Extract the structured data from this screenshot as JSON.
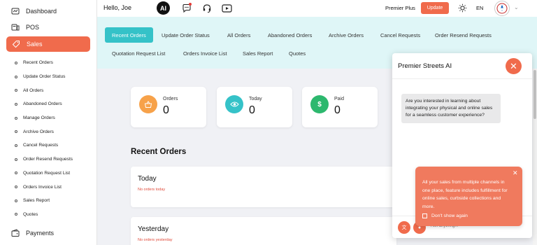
{
  "sidebar": {
    "dashboard": "Dashboard",
    "pos": "POS",
    "sales": "Sales",
    "payments": "Payments",
    "sub_items": [
      "Recent Orders",
      "Update Order Status",
      "All Orders",
      "Abandoned Orders",
      "Manage Orders",
      "Archive Orders",
      "Cancel Requests",
      "Order Resend Requests",
      "Quotation Request List",
      "Orders Invoice List",
      "Sales Report",
      "Quotes"
    ]
  },
  "topbar": {
    "greeting": "Hello, Joe",
    "ai_badge": "AI",
    "plan": "Premier Plus",
    "update_label": "Update",
    "language": "EN"
  },
  "tabs": [
    "Recent Orders",
    "Update Order Status",
    "All Orders",
    "Abandoned Orders",
    "Archive Orders",
    "Cancel Requests",
    "Order Resend Requests",
    "Quotation Request List",
    "Orders Invoice List",
    "Sales Report",
    "Quotes"
  ],
  "stats": [
    {
      "label": "Orders",
      "value": "0",
      "color": "#f7a24a",
      "icon": "basket-icon"
    },
    {
      "label": "Today",
      "value": "0",
      "color": "#35c2c8",
      "icon": "eye-icon"
    },
    {
      "label": "Paid",
      "value": "0",
      "color": "#2db86e",
      "icon": "dollar-icon"
    }
  ],
  "recent": {
    "title": "Recent Orders",
    "groups": [
      {
        "title": "Today",
        "empty": "No orders today"
      },
      {
        "title": "Yesterday",
        "empty": "No orders yesterday"
      }
    ]
  },
  "ai_panel": {
    "title": "Premier Streets AI",
    "message": "Are you interested in learning about integrating your physical and online sales for a seamless customer experience?",
    "input_placeholder": "Ask anything..."
  },
  "promo": {
    "text": "All your sales from multiple channels in one place, feature includes fulfillment for online sales, curbside collections and more.",
    "dont_show": "Don't show again"
  },
  "colors": {
    "accent": "#f06b4c",
    "teal": "#35c2c8",
    "tabs_bg": "#dff6f7"
  }
}
